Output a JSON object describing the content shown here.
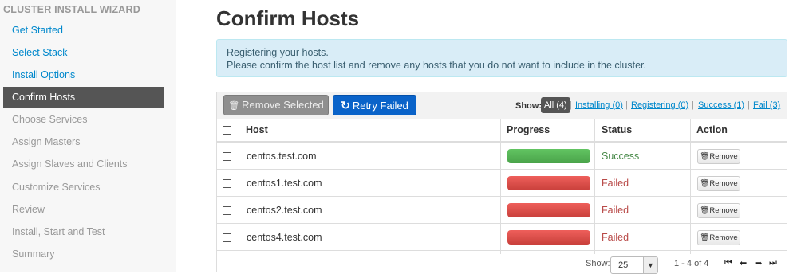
{
  "sidebar": {
    "title": "CLUSTER INSTALL WIZARD",
    "items": [
      {
        "label": "Get Started",
        "state": "done"
      },
      {
        "label": "Select Stack",
        "state": "done"
      },
      {
        "label": "Install Options",
        "state": "done"
      },
      {
        "label": "Confirm Hosts",
        "state": "current"
      },
      {
        "label": "Choose Services",
        "state": "future"
      },
      {
        "label": "Assign Masters",
        "state": "future"
      },
      {
        "label": "Assign Slaves and Clients",
        "state": "future"
      },
      {
        "label": "Customize Services",
        "state": "future"
      },
      {
        "label": "Review",
        "state": "future"
      },
      {
        "label": "Install, Start and Test",
        "state": "future"
      },
      {
        "label": "Summary",
        "state": "future"
      }
    ]
  },
  "main": {
    "title": "Confirm Hosts",
    "alert": {
      "line1": "Registering your hosts.",
      "line2": "Please confirm the host list and remove any hosts that you do not want to include in the cluster."
    }
  },
  "toolbar": {
    "remove_selected": "Remove Selected",
    "retry_failed": "Retry Failed",
    "show_label": "Show:",
    "filters": [
      "All (4)",
      "Installing (0)",
      "Registering (0)",
      "Success (1)",
      "Fail (3)"
    ],
    "separator": "|"
  },
  "table": {
    "columns": [
      "Host",
      "Progress",
      "Status",
      "Action"
    ],
    "rows": [
      {
        "host": "centos.test.com",
        "progress": 1.0,
        "status": "Success",
        "action": "Remove"
      },
      {
        "host": "centos1.test.com",
        "progress": 1.0,
        "status": "Failed",
        "action": "Remove"
      },
      {
        "host": "centos2.test.com",
        "progress": 1.0,
        "status": "Failed",
        "action": "Remove"
      },
      {
        "host": "centos4.test.com",
        "progress": 1.0,
        "status": "Failed",
        "action": "Remove"
      }
    ]
  },
  "footer": {
    "show_label": "Show:",
    "page_size": "25",
    "range": "1 - 4 of 4"
  },
  "colors": {
    "success": "#468847",
    "failed": "#b94a48",
    "primary": "#0a63c9",
    "link": "#0088cc"
  }
}
